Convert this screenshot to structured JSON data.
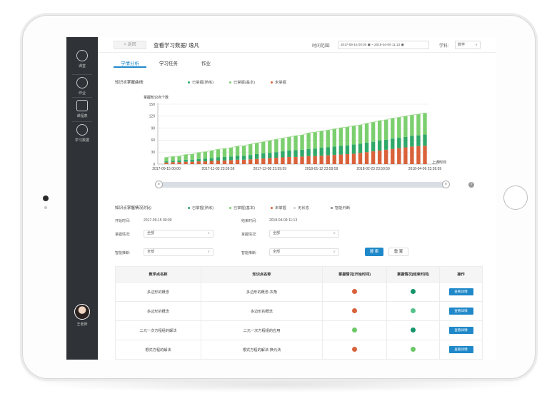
{
  "sidebar": {
    "items": [
      {
        "label": "课堂",
        "icon": "classroom-icon"
      },
      {
        "label": "作业",
        "icon": "homework-icon"
      },
      {
        "label": "课程表",
        "icon": "schedule-icon"
      },
      {
        "label": "学习数据",
        "icon": "learning-data-icon"
      }
    ],
    "user_name": "王老师"
  },
  "header": {
    "back_label": "< 返回",
    "title": "查看学习数据/ 逸凡",
    "range_label": "时间范围:",
    "range_value": "2017-09-15 00:00  ▣  ~  2018-04-09 11:13  ▣",
    "subject_label": "学科:",
    "subject_value": "数学"
  },
  "tabs": [
    {
      "label": "学情分析",
      "active": true
    },
    {
      "label": "学习任务",
      "active": false
    },
    {
      "label": "作业",
      "active": false
    }
  ],
  "curve_section": {
    "label": "知识点掌握曲线:",
    "legend": [
      {
        "label": "已掌握(熟练)",
        "color": "#2fa86a"
      },
      {
        "label": "已掌握(基本)",
        "color": "#7ccf6f"
      },
      {
        "label": "未掌握",
        "color": "#d9623b"
      }
    ]
  },
  "chart_data": {
    "type": "bar",
    "stacked": true,
    "ylabel": "掌握知识点个数",
    "xlabel": "上课时间",
    "ylim": [
      0,
      150
    ],
    "yticks": [
      0,
      30,
      60,
      90,
      120,
      150
    ],
    "xtick_labels": [
      "2017-09-15 00:00",
      "2017-11-03 23:59:59",
      "2017-12-08 23:59:59",
      "2018-01-12 23:59:59",
      "2018-02-23 23:59:59",
      "2018-04-06 23:59:59"
    ],
    "series": [
      {
        "name": "未掌握",
        "color": "#d9623b",
        "values": [
          4,
          5,
          5,
          6,
          6,
          7,
          7,
          8,
          9,
          9,
          10,
          11,
          11,
          12,
          13,
          14,
          15,
          16,
          17,
          18,
          18,
          19,
          20,
          20,
          21,
          22,
          23,
          24,
          25,
          26,
          28,
          30,
          32,
          34,
          36,
          38,
          40,
          42,
          44,
          45,
          46
        ]
      },
      {
        "name": "已掌握(熟练)",
        "color": "#2fa86a",
        "values": [
          3,
          3,
          4,
          5,
          5,
          6,
          7,
          7,
          8,
          9,
          9,
          10,
          10,
          11,
          12,
          13,
          13,
          14,
          15,
          16,
          17,
          17,
          18,
          19,
          20,
          20,
          21,
          22,
          22,
          23,
          23,
          24,
          24,
          25,
          25,
          26,
          26,
          26,
          27,
          27,
          28
        ]
      },
      {
        "name": "已掌握(基本)",
        "color": "#7ccf6f",
        "values": [
          10,
          11,
          11,
          13,
          14,
          16,
          17,
          19,
          20,
          21,
          22,
          24,
          25,
          27,
          28,
          29,
          31,
          32,
          33,
          34,
          36,
          37,
          40,
          41,
          42,
          43,
          44,
          45,
          46,
          47,
          47,
          48,
          49,
          50,
          50,
          51,
          51,
          52,
          52,
          53,
          54
        ]
      }
    ]
  },
  "compare_section": {
    "label": "知识点掌握情况对比:",
    "legend": [
      {
        "label": "已掌握(熟练)",
        "color": "#2fa86a"
      },
      {
        "label": "已掌握(基本)",
        "color": "#7ccf6f"
      },
      {
        "label": "未掌握",
        "color": "#d9623b"
      },
      {
        "label": "无状态",
        "color": "#cfcfcf"
      },
      {
        "label": "智能判断",
        "color": "#888888"
      }
    ],
    "start_label": "开始时间:",
    "start_value": "2017-09-15 00:00",
    "end_label": "结束时间:",
    "end_value": "2018-04-09 11:13"
  },
  "filters": {
    "mastery_label_1": "掌握情况:",
    "mastery_value_1": "全部",
    "mastery_label_2": "掌握情况:",
    "mastery_value_2": "全部",
    "smart_label_1": "智能推断:",
    "smart_value_1": "全部",
    "smart_label_2": "智能推断:",
    "smart_value_2": "全部",
    "search_label": "搜 索",
    "reset_label": "重 置"
  },
  "table": {
    "headers": [
      "教学点名称",
      "知识点名称",
      "掌握情况(开始时间)",
      "掌握情况(结束时间)",
      "操作"
    ],
    "rows": [
      {
        "teaching_point": "多边形的概念",
        "knowledge_point": "多边形的概念-农角",
        "start_color": "#d9623b",
        "end_color": "#16956a",
        "action": "查看详情"
      },
      {
        "teaching_point": "多边形的概念",
        "knowledge_point": "多边形的概念",
        "start_color": "#d9623b",
        "end_color": "#55c08a",
        "action": "查看详情"
      },
      {
        "teaching_point": "二元一次方程组的解法",
        "knowledge_point": "二元一次方程组的应用",
        "start_color": "#6cc766",
        "end_color": "#16956a",
        "action": "查看详情"
      },
      {
        "teaching_point": "根式方程的解法",
        "knowledge_point": "根式方程的解法-换元法",
        "start_color": "#d9623b",
        "end_color": "#6cc766",
        "action": "查看详情"
      }
    ]
  }
}
